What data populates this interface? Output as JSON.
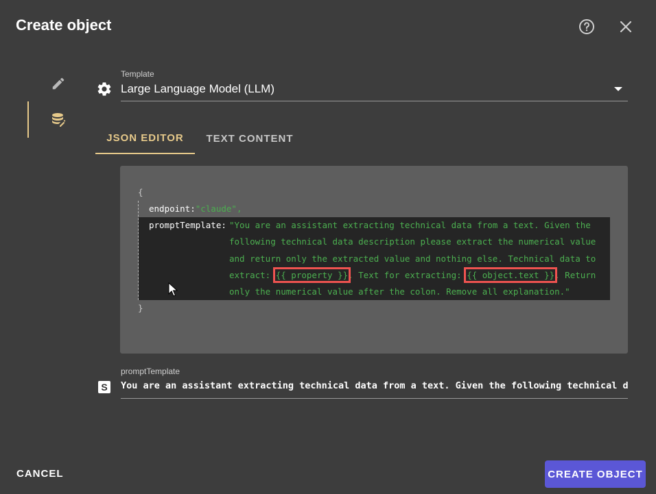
{
  "dialog": {
    "title": "Create object"
  },
  "template": {
    "label": "Template",
    "value": "Large Language Model (LLM)"
  },
  "tabs": [
    {
      "label": "JSON EDITOR",
      "active": true
    },
    {
      "label": "TEXT CONTENT",
      "active": false
    }
  ],
  "json_editor": {
    "open_brace": "{",
    "close_brace": "}",
    "endpoint_key": "endpoint:",
    "endpoint_value": "\"claude\",",
    "prompt_key": "promptTemplate:",
    "prompt_lines": {
      "line1": "\"You are an assistant extracting technical data from a text. Given the",
      "line2": "following technical data description please extract the numerical value",
      "line3": "and return only the extracted value and nothing else. Technical data to",
      "line4_a": "extract: ",
      "line4_hl1": "{{ property }}",
      "line4_b": ". Text for extracting: ",
      "line4_hl2": "{{ object.text }}",
      "line4_c": ". Return",
      "line5": "only the numerical value after the colon. Remove all explanation.\""
    }
  },
  "field": {
    "label": "promptTemplate",
    "icon": "S",
    "value": "You are an assistant extracting technical data from a text. Given the following technical data description please extract the numerical value"
  },
  "footer": {
    "cancel": "CANCEL",
    "create": "CREATE OBJECT"
  },
  "colors": {
    "accent": "#e6c98a",
    "primary": "#5b57d6",
    "string": "#4caf50",
    "highlight": "#ef5350"
  }
}
